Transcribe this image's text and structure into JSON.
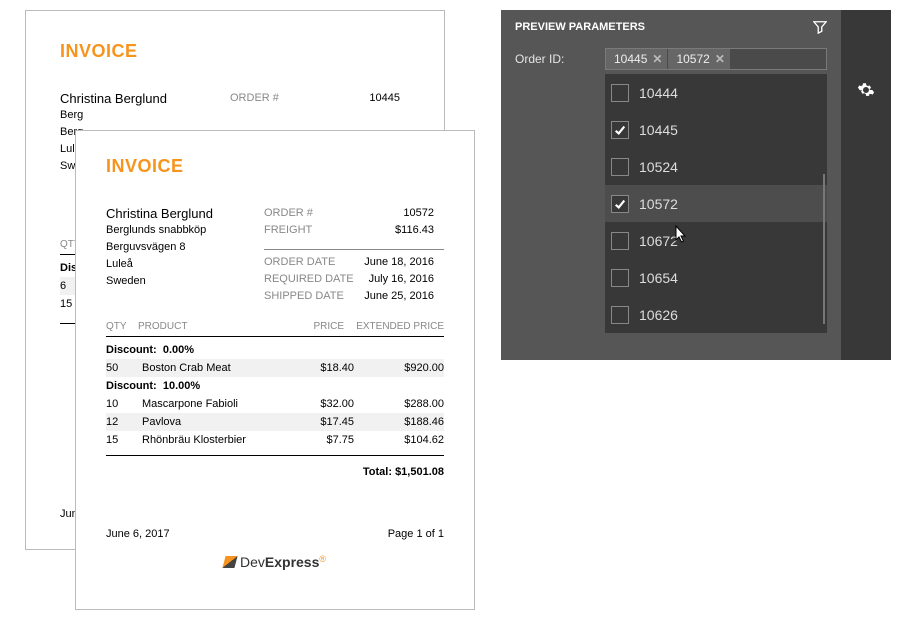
{
  "invoice_back": {
    "title": "INVOICE",
    "customer_name": "Christina Berglund",
    "addr1": "Berg",
    "addr2": "Berg",
    "addr3": "Luleå",
    "addr4": "Swed",
    "order": {
      "label": "ORDER #",
      "value": "10445"
    },
    "cols": {
      "qty": "QTY"
    },
    "disc_label": "Disc",
    "row1_qty": "6",
    "row2_qty": "15",
    "date": "June"
  },
  "invoice_front": {
    "title": "INVOICE",
    "customer_name": "Christina Berglund",
    "company": "Berglunds snabbköp",
    "street": "Berguvsvägen 8",
    "city": "Luleå",
    "country": "Sweden",
    "order": {
      "label": "ORDER #",
      "value": "10572"
    },
    "freight": {
      "label": "FREIGHT",
      "value": "$116.43"
    },
    "order_date": {
      "label": "ORDER DATE",
      "value": "June 18, 2016"
    },
    "required_date": {
      "label": "REQUIRED DATE",
      "value": "July 16, 2016"
    },
    "shipped_date": {
      "label": "SHIPPED DATE",
      "value": "June 25, 2016"
    },
    "cols": {
      "qty": "QTY",
      "product": "PRODUCT",
      "price": "PRICE",
      "ext": "EXTENDED PRICE"
    },
    "groups": [
      {
        "label": "Discount:",
        "pct": "0.00%",
        "rows": [
          {
            "qty": "50",
            "name": "Boston Crab Meat",
            "price": "$18.40",
            "ext": "$920.00",
            "shade": true
          }
        ]
      },
      {
        "label": "Discount:",
        "pct": "10.00%",
        "rows": [
          {
            "qty": "10",
            "name": "Mascarpone Fabioli",
            "price": "$32.00",
            "ext": "$288.00"
          },
          {
            "qty": "12",
            "name": "Pavlova",
            "price": "$17.45",
            "ext": "$188.46",
            "shade": true
          },
          {
            "qty": "15",
            "name": "Rhönbräu Klosterbier",
            "price": "$7.75",
            "ext": "$104.62"
          }
        ]
      }
    ],
    "total_label": "Total:",
    "total_value": "$1,501.08",
    "footer_date": "June 6, 2017",
    "footer_page": "Page 1 of 1",
    "logo_dev": "Dev",
    "logo_exp": "Express"
  },
  "panel": {
    "title": "PREVIEW PARAMETERS",
    "param_label": "Order ID:",
    "selected": [
      "10445",
      "10572"
    ],
    "options": [
      {
        "value": "10444",
        "checked": false
      },
      {
        "value": "10445",
        "checked": true
      },
      {
        "value": "10524",
        "checked": false
      },
      {
        "value": "10572",
        "checked": true,
        "hover": true
      },
      {
        "value": "10672",
        "checked": false
      },
      {
        "value": "10654",
        "checked": false
      },
      {
        "value": "10626",
        "checked": false
      }
    ]
  }
}
